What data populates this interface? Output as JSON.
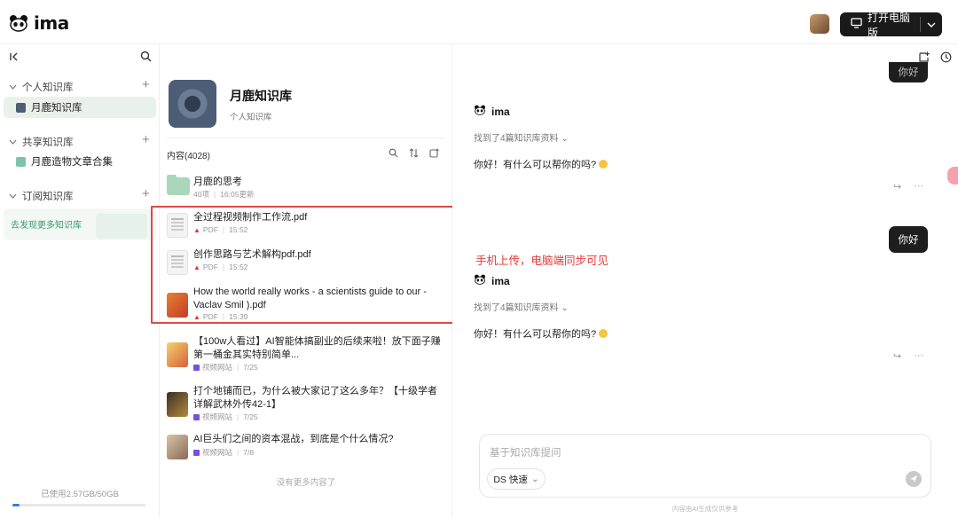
{
  "app": {
    "logo_text": "ima"
  },
  "header": {
    "open_desktop_label": "打开电脑版"
  },
  "sidebar": {
    "personal_section": "个人知识库",
    "personal_items": [
      {
        "label": "月鹿知识库"
      }
    ],
    "shared_section": "共享知识库",
    "shared_items": [
      {
        "label": "月鹿造物文章合集"
      }
    ],
    "subscribed_section": "订阅知识库",
    "discover_label": "去发现更多知识库",
    "storage_text": "已使用2.57GB/50GB",
    "storage_used_fraction": 0.05
  },
  "kb": {
    "title": "月鹿知识库",
    "subtitle": "个人知识库",
    "content_header": "内容(4028)",
    "items": [
      {
        "title": "月鹿的思考",
        "meta1": "40项",
        "meta2": "16:05更新",
        "kind": "folder"
      },
      {
        "title": "全过程视频制作工作流.pdf",
        "meta1": "PDF",
        "meta2": "15:52",
        "kind": "pdf"
      },
      {
        "title": "创作思路与艺术解构pdf.pdf",
        "meta1": "PDF",
        "meta2": "15:52",
        "kind": "pdf"
      },
      {
        "title": "How the world really works - a scientists guide to our - Vaclav Smil ).pdf",
        "meta1": "PDF",
        "meta2": "15:39",
        "kind": "pdf"
      },
      {
        "title": "【100w人看过】AI智能体搞副业的后续来啦！放下面子赚第一桶金其实特别简单...",
        "meta1": "视频网站",
        "meta2": "7/25",
        "kind": "video"
      },
      {
        "title": "打个地铺而已，为什么被大家记了这么多年？【十级学者详解武林外传42-1】",
        "meta1": "视频网站",
        "meta2": "7/25",
        "kind": "video"
      },
      {
        "title": "AI巨头们之间的资本混战，到底是个什么情况?",
        "meta1": "视频网站",
        "meta2": "7/8",
        "kind": "video"
      }
    ],
    "no_more": "没有更多内容了"
  },
  "chat": {
    "top_bubble_partial": "你好",
    "bot_name": "ima",
    "found_text": "找到了4篇知识库资料",
    "reply_text": "你好！有什么可以帮你的吗?",
    "user_message": "你好",
    "annotation": "手机上传，电脑端同步可见",
    "input_placeholder": "基于知识库提问",
    "model_chip": "DS 快速",
    "disclaimer": "内容由AI生成仅供参考"
  },
  "colors": {
    "accent": "#1a1a1a",
    "highlight": "#e04848",
    "active_item": "#eaf1ea",
    "annotation": "#e03a3a"
  }
}
